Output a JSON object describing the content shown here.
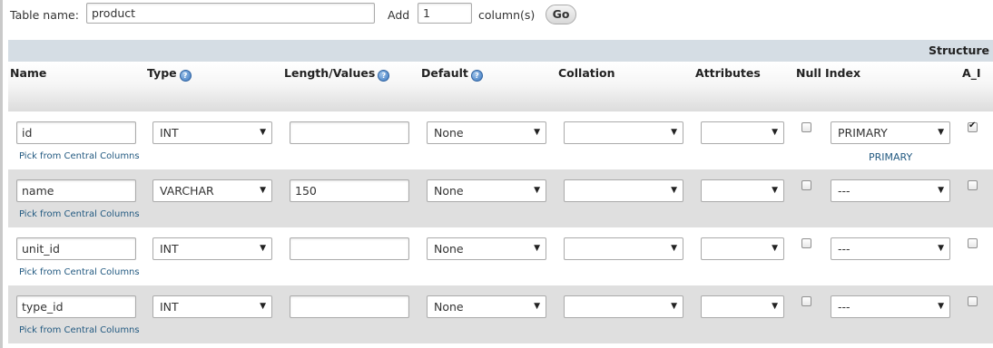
{
  "topbar": {
    "table_name_label": "Table name:",
    "table_name_value": "product",
    "add_label": "Add",
    "add_count": "1",
    "columns_label": "column(s)",
    "go_label": "Go"
  },
  "header": {
    "structure_label": "Structure",
    "columns": {
      "name": "Name",
      "type": "Type",
      "length": "Length/Values",
      "default": "Default",
      "collation": "Collation",
      "attributes": "Attributes",
      "null": "Null",
      "index": "Index",
      "ai": "A_I"
    },
    "help_icon": "help-icon"
  },
  "rows": [
    {
      "name": "id",
      "type": "INT",
      "length": "",
      "default": "None",
      "collation": "",
      "attributes": "",
      "null_checked": false,
      "index": "PRIMARY",
      "index_note": "PRIMARY",
      "ai_checked": true,
      "pick_link": "Pick from Central Columns"
    },
    {
      "name": "name",
      "type": "VARCHAR",
      "length": "150",
      "default": "None",
      "collation": "",
      "attributes": "",
      "null_checked": false,
      "index": "---",
      "index_note": "",
      "ai_checked": false,
      "pick_link": "Pick from Central Columns"
    },
    {
      "name": "unit_id",
      "type": "INT",
      "length": "",
      "default": "None",
      "collation": "",
      "attributes": "",
      "null_checked": false,
      "index": "---",
      "index_note": "",
      "ai_checked": false,
      "pick_link": "Pick from Central Columns"
    },
    {
      "name": "type_id",
      "type": "INT",
      "length": "",
      "default": "None",
      "collation": "",
      "attributes": "",
      "null_checked": false,
      "index": "---",
      "index_note": "",
      "ai_checked": false,
      "pick_link": "Pick from Central Columns"
    }
  ],
  "colors": {
    "header_band": "#d5dde4",
    "row_alt": "#dfdfdf",
    "link": "#235a81"
  }
}
